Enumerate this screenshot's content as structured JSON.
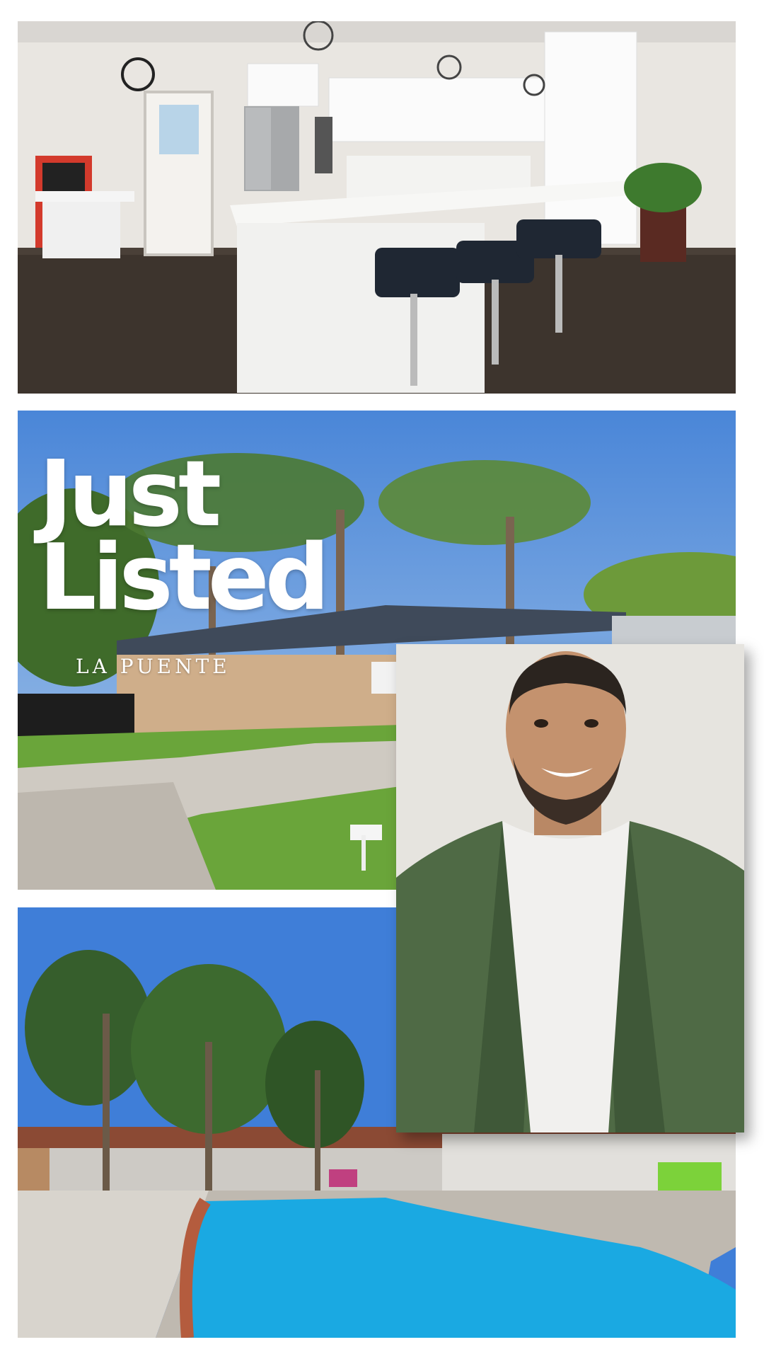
{
  "headline": {
    "line1": "Just",
    "line2": "Listed"
  },
  "location": "LA PUENTE",
  "colors": {
    "text": "#ffffff",
    "sky": "#5b8fd6",
    "pool": "#17b3e8",
    "lawn": "#6aa53a",
    "jacket": "#4f6a45"
  },
  "photos": [
    {
      "subject": "kitchen"
    },
    {
      "subject": "house-exterior"
    },
    {
      "subject": "backyard-pool"
    }
  ],
  "agent": {
    "subject": "agent-portrait"
  }
}
